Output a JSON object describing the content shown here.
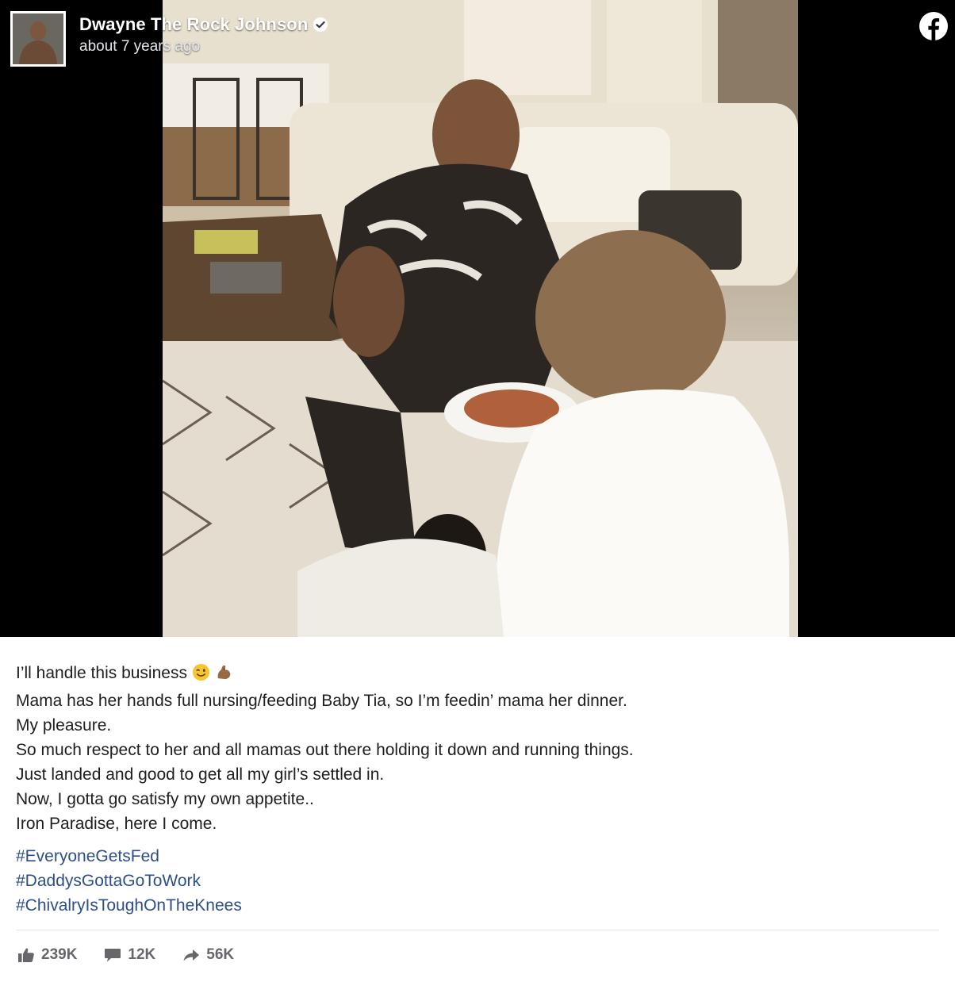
{
  "post": {
    "author": "Dwayne The Rock Johnson",
    "timestamp": "about 7 years ago",
    "verified_icon": "verified-badge-icon",
    "platform_icon": "facebook-logo-icon",
    "photo_icon": "post-photo",
    "caption_lines": [
      "I’ll handle this business",
      "Mama has her hands full nursing/feeding Baby Tia, so I’m feedin’ mama her dinner.",
      "My pleasure.",
      "So much respect to her and all mamas out there holding it down and running things.",
      "Just landed and good to get all my girl’s settled in.",
      "Now, I gotta go satisfy my own appetite..",
      "Iron Paradise, here I come."
    ],
    "caption_emojis": [
      "winking-face-emoji",
      "flexed-biceps-emoji"
    ],
    "hashtags": [
      "#EveryoneGetsFed",
      "#DaddysGottaGoToWork",
      "#ChivalryIsToughOnTheKnees"
    ],
    "stats": {
      "likes": "239K",
      "comments": "12K",
      "shares": "56K"
    },
    "colors": {
      "hashtag": "#2d4f86",
      "stat_text": "#65676b",
      "media_background": "#000000"
    }
  }
}
